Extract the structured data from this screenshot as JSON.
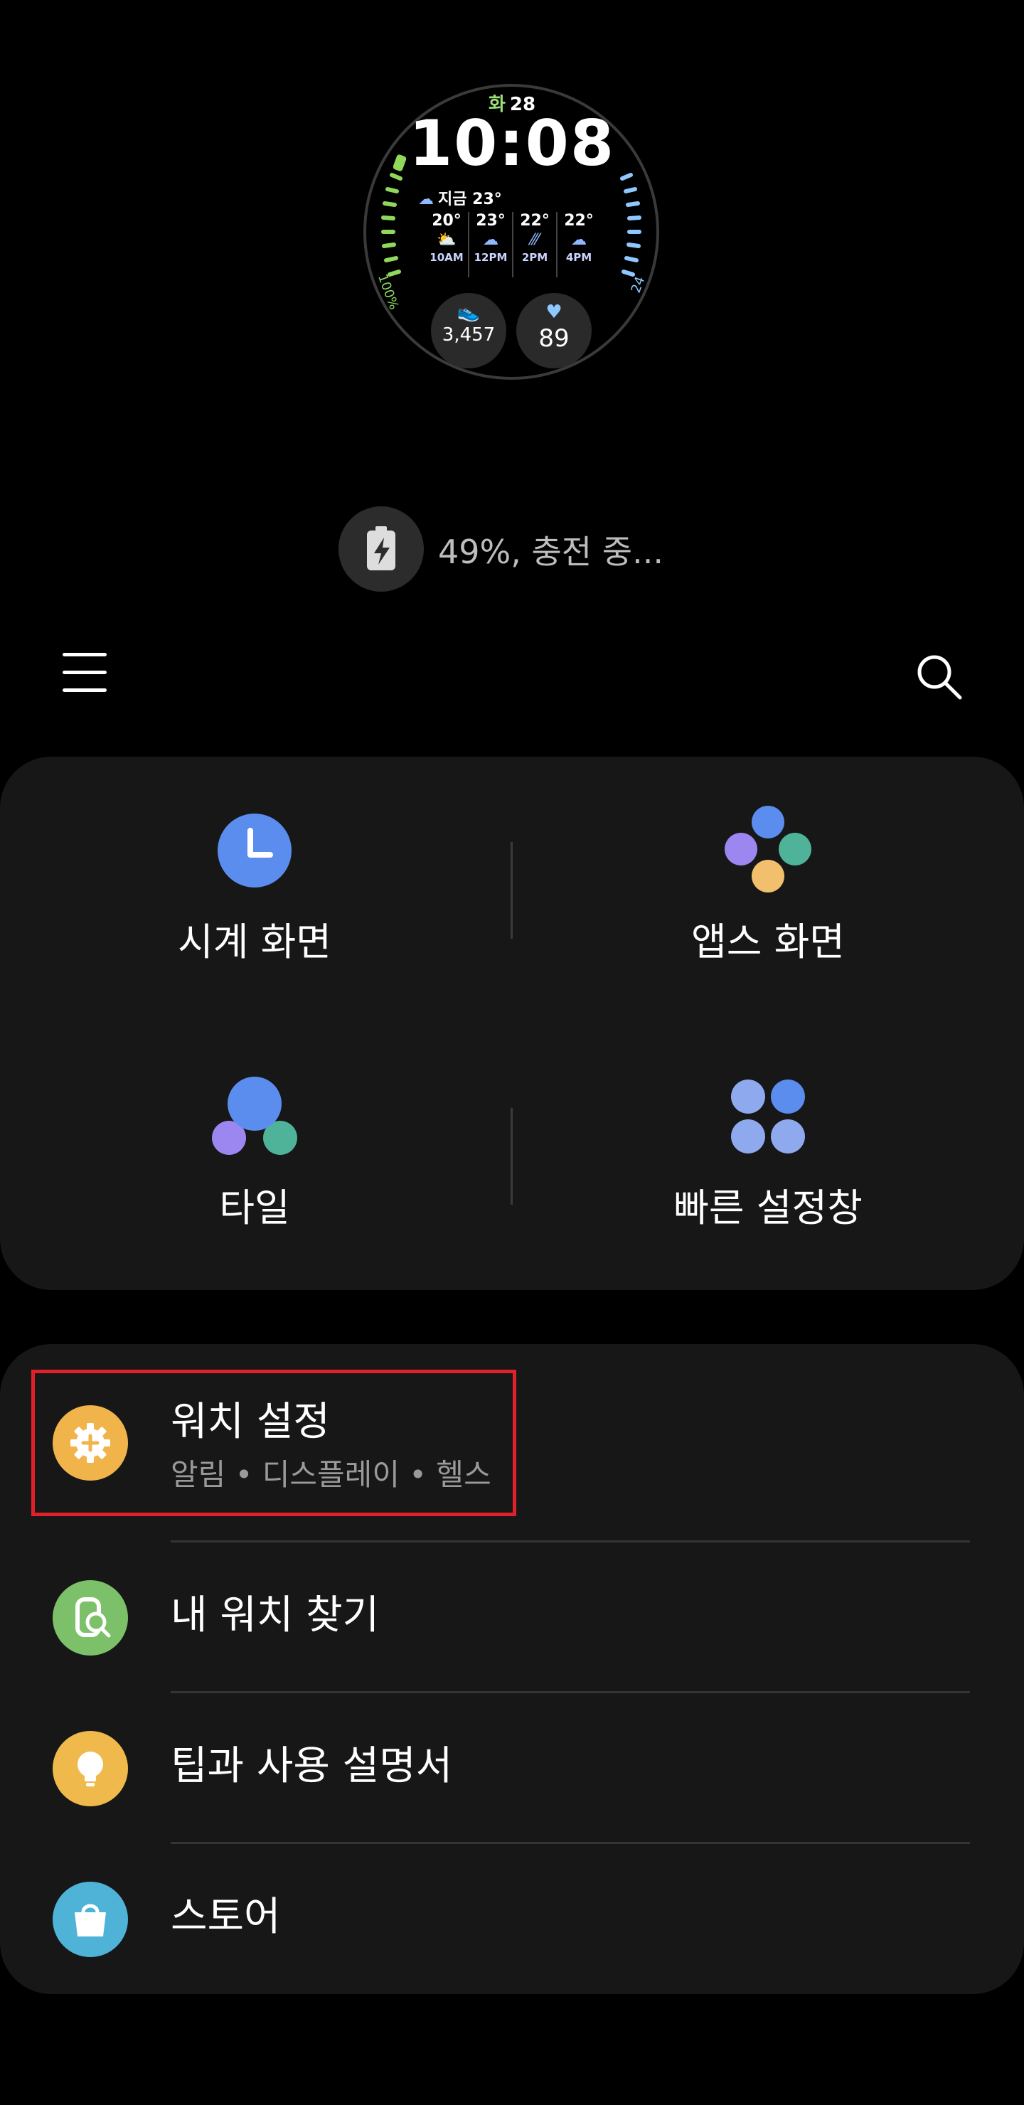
{
  "watch": {
    "day": "화",
    "date": "28",
    "time": "10:08",
    "now_label": "지금 23°",
    "forecast": [
      {
        "temp": "20°",
        "hour": "10AM"
      },
      {
        "temp": "23°",
        "hour": "12PM"
      },
      {
        "temp": "22°",
        "hour": "2PM"
      },
      {
        "temp": "22°",
        "hour": "4PM"
      }
    ],
    "steps": "3,457",
    "heart_rate": "89",
    "left_gauge_label": "100%",
    "right_gauge_label": "24"
  },
  "battery": {
    "text": "49%, 충전 중..."
  },
  "grid": {
    "watch_faces": "시계 화면",
    "apps_screen": "앱스 화면",
    "tiles": "타일",
    "quick_panel": "빠른 설정창"
  },
  "menu": {
    "watch_settings": {
      "title": "워치 설정",
      "subtitle": "알림 • 디스플레이 • 헬스"
    },
    "find_watch": {
      "title": "내 워치 찾기"
    },
    "tips": {
      "title": "팁과 사용 설명서"
    },
    "store": {
      "title": "스토어"
    }
  },
  "colors": {
    "accent_blue": "#5b8def",
    "settings_icon": "#f0b44a",
    "find_icon": "#7cc06a",
    "tips_icon": "#f0b94c",
    "store_icon": "#4fb3d8",
    "highlight_box": "#e0202a"
  }
}
